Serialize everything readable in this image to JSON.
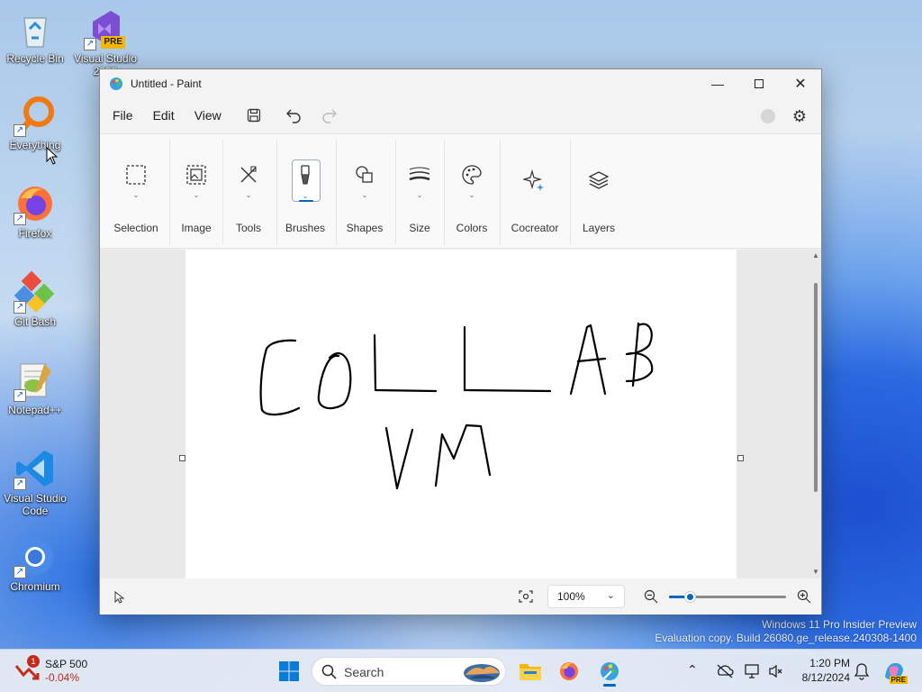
{
  "desktop": {
    "icons": [
      {
        "label": "Recycle Bin",
        "icon": "recycle-bin-icon"
      },
      {
        "label": "Visual Studio 2022",
        "badge": "PRE",
        "icon": "visual-studio-icon"
      },
      {
        "label": "Everything",
        "icon": "everything-icon"
      },
      {
        "label": "Firefox",
        "icon": "firefox-icon"
      },
      {
        "label": "Git Bash",
        "icon": "git-bash-icon"
      },
      {
        "label": "Notepad++",
        "icon": "notepad-plus-plus-icon"
      },
      {
        "label": "Visual Studio Code",
        "icon": "vscode-icon"
      },
      {
        "label": "Chromium",
        "icon": "chromium-icon"
      }
    ],
    "watermark_line1": "Windows 11 Pro Insider Preview",
    "watermark_line2": "Evaluation copy. Build 26080.ge_release.240308-1400"
  },
  "window": {
    "title": "Untitled - Paint",
    "controls": {
      "minimize": "minimize-icon",
      "maximize": "maximize-icon",
      "close": "close-icon"
    }
  },
  "menubar": {
    "file": "File",
    "edit": "Edit",
    "view": "View"
  },
  "ribbon": {
    "groups": [
      {
        "label": "Selection",
        "icon": "selection-icon"
      },
      {
        "label": "Image",
        "icon": "image-icon"
      },
      {
        "label": "Tools",
        "icon": "tools-icon"
      },
      {
        "label": "Brushes",
        "icon": "brush-icon",
        "active": true
      },
      {
        "label": "Shapes",
        "icon": "shapes-icon"
      },
      {
        "label": "Size",
        "icon": "size-icon"
      },
      {
        "label": "Colors",
        "icon": "palette-icon"
      },
      {
        "label": "Cocreator",
        "icon": "cocreator-icon"
      },
      {
        "label": "Layers",
        "icon": "layers-icon"
      }
    ]
  },
  "canvas": {
    "drawing_lines": [
      "COLLAB",
      "VM"
    ]
  },
  "statusbar": {
    "zoom": "100%"
  },
  "taskbar": {
    "widget": {
      "title": "S&P 500",
      "change": "-0.04%",
      "badge": "1"
    },
    "search_placeholder": "Search",
    "time": "1:20 PM",
    "date": "8/12/2024",
    "colors": {
      "negative": "#c42b1c",
      "accent": "#0067c0"
    }
  }
}
